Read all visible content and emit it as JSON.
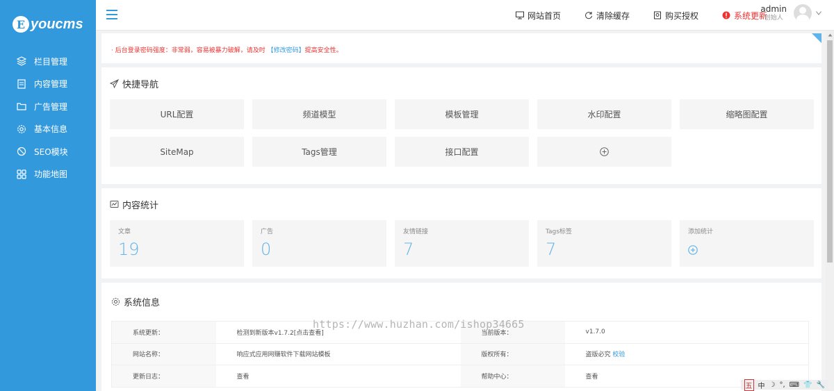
{
  "app": {
    "logo_letter": "E",
    "logo_text": "youcms"
  },
  "sidebar": {
    "items": [
      {
        "label": "栏目管理",
        "icon": "layers-icon"
      },
      {
        "label": "内容管理",
        "icon": "document-icon"
      },
      {
        "label": "广告管理",
        "icon": "folder-icon"
      },
      {
        "label": "基本信息",
        "icon": "gear-icon"
      },
      {
        "label": "SEO模块",
        "icon": "seo-icon"
      },
      {
        "label": "功能地图",
        "icon": "grid-icon"
      }
    ]
  },
  "header": {
    "links": [
      {
        "label": "网站首页",
        "icon": "monitor-icon"
      },
      {
        "label": "清除缓存",
        "icon": "refresh-icon"
      },
      {
        "label": "购买授权",
        "icon": "shield-icon"
      },
      {
        "label": "系统更新",
        "icon": "alert-icon"
      }
    ],
    "user_name": "admin",
    "user_role": "创始人"
  },
  "notice": {
    "prefix": "· 后台登录密码强度：非常弱，容易被暴力破解，请及时 ",
    "link": "【修改密码】",
    "suffix": "提高安全性。"
  },
  "quick_nav": {
    "title": "快捷导航",
    "items": [
      "URL配置",
      "频道模型",
      "模板管理",
      "水印配置",
      "缩略图配置",
      "SiteMap",
      "Tags管理",
      "接口配置"
    ]
  },
  "stats": {
    "title": "内容统计",
    "items": [
      {
        "label": "文章",
        "value": "19"
      },
      {
        "label": "广告",
        "value": "0"
      },
      {
        "label": "友情链接",
        "value": "7"
      },
      {
        "label": "Tags标签",
        "value": "7"
      }
    ],
    "add_label": "添加统计"
  },
  "sysinfo": {
    "title": "系统信息",
    "rows": [
      {
        "k1": "系统更新：",
        "v1": "检测到新版本v1.7.2[点击查看]",
        "k2": "当前版本：",
        "v2": "v1.7.0"
      },
      {
        "k1": "网站名称：",
        "v1": "响应式应用网赚软件下载网站模板",
        "k2": "版权所有：",
        "v2": "盗版必究",
        "v2_link": "校验"
      },
      {
        "k1": "更新日志：",
        "v1": "查看",
        "k2": "帮助中心：",
        "v2": "查看"
      }
    ]
  },
  "watermark": "https://www.huzhan.com/ishop34665",
  "tray": [
    "五",
    "中",
    "☽",
    "°,",
    "⌨",
    "👕",
    "🔧"
  ],
  "colors": {
    "sidebar": "#3399dd",
    "accent": "#61b4e8",
    "alert": "#ee3333"
  }
}
